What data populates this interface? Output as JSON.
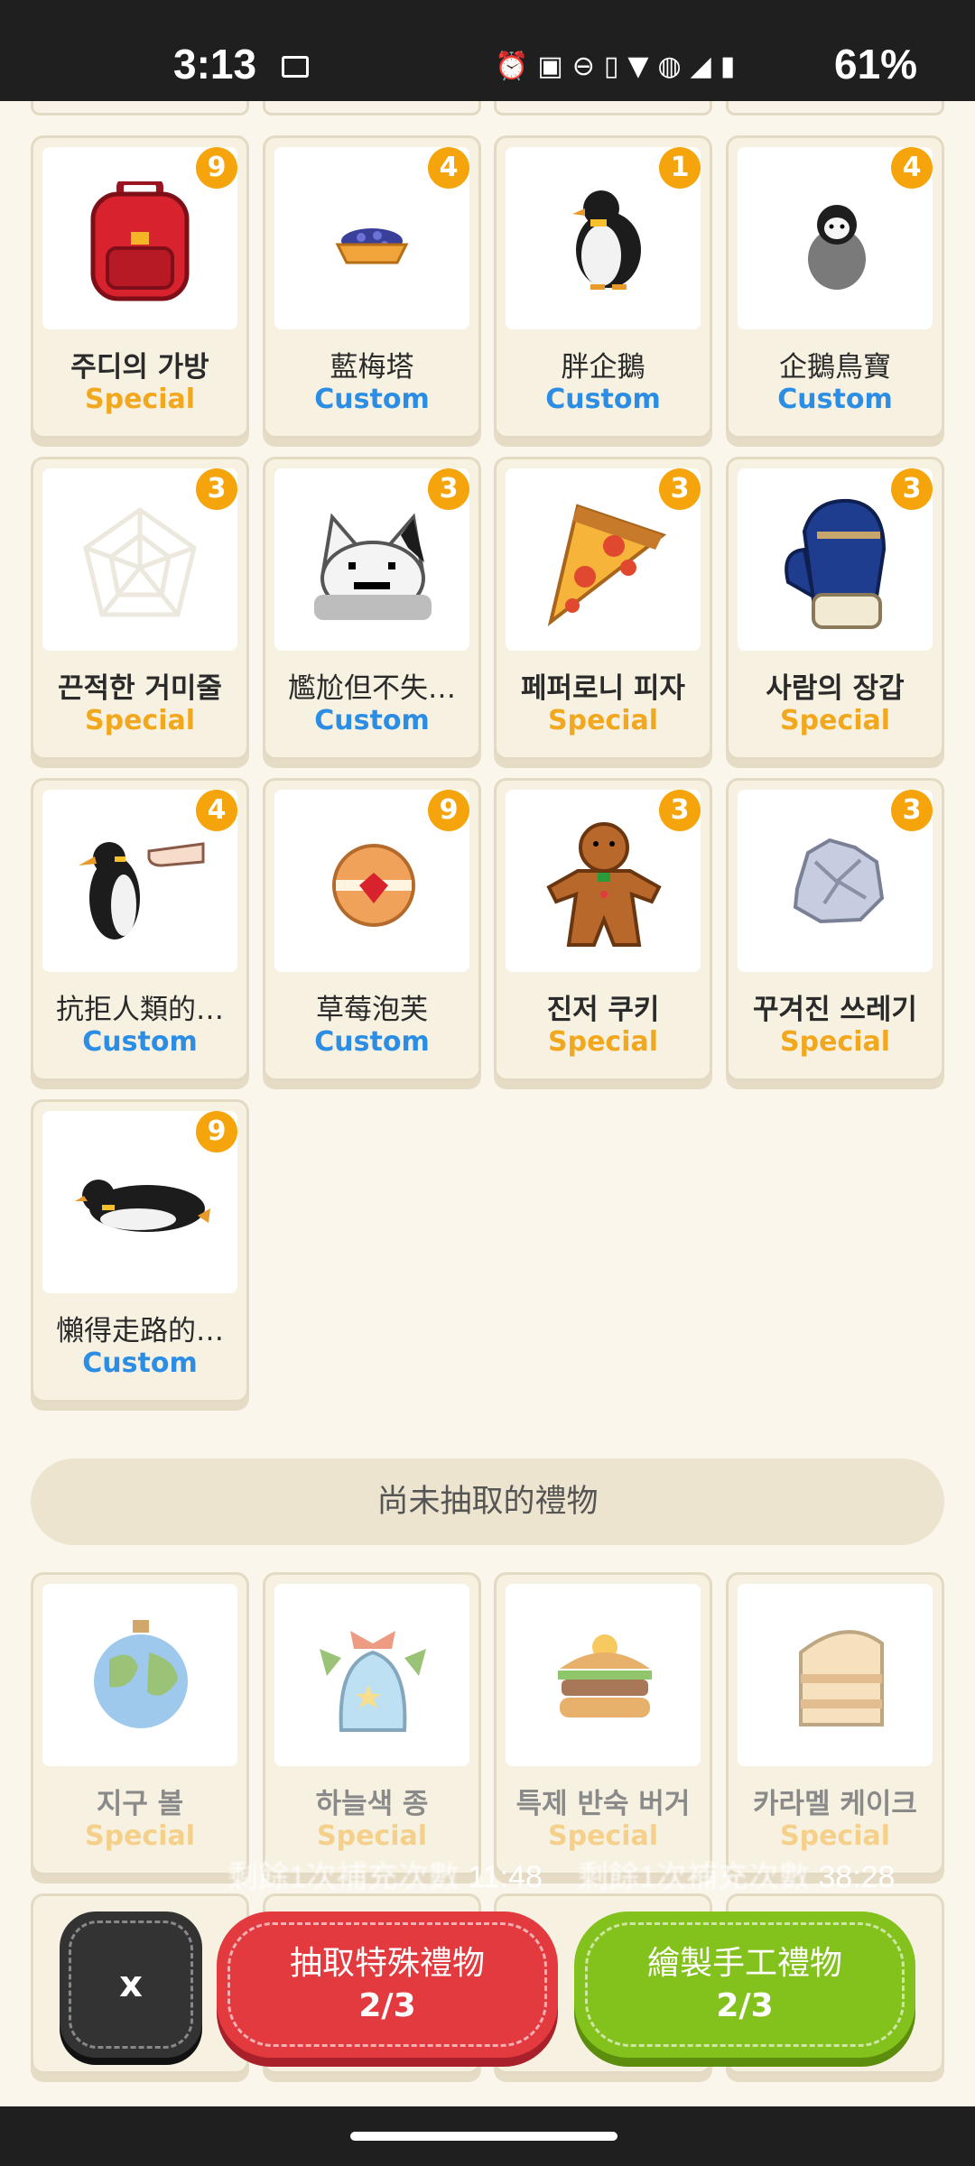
{
  "status_bar": {
    "time": "3:13",
    "battery": "61%",
    "icons": [
      "image-icon",
      "alarm-icon",
      "auto-hz-icon",
      "dnd-icon",
      "vibrate-icon",
      "wifi-icon",
      "volte-icon",
      "signal-icon",
      "battery-icon"
    ]
  },
  "owned_gifts": [
    {
      "name": "주디의 가방",
      "type": "Special",
      "count": "9",
      "icon": "red-backpack"
    },
    {
      "name": "藍梅塔",
      "type": "Custom",
      "count": "4",
      "icon": "blueberry-tart"
    },
    {
      "name": "胖企鵝",
      "type": "Custom",
      "count": "1",
      "icon": "fat-penguin"
    },
    {
      "name": "企鵝鳥寶",
      "type": "Custom",
      "count": "4",
      "icon": "baby-penguin"
    },
    {
      "name": "끈적한 거미줄",
      "type": "Special",
      "count": "3",
      "icon": "spider-web"
    },
    {
      "name": "尷尬但不失…",
      "type": "Custom",
      "count": "3",
      "icon": "awkward-cat"
    },
    {
      "name": "페퍼로니 피자",
      "type": "Special",
      "count": "3",
      "icon": "pizza-slice"
    },
    {
      "name": "사람의 장갑",
      "type": "Special",
      "count": "3",
      "icon": "mitten"
    },
    {
      "name": "抗拒人類的…",
      "type": "Custom",
      "count": "4",
      "icon": "penguin-hand"
    },
    {
      "name": "草莓泡芙",
      "type": "Custom",
      "count": "9",
      "icon": "strawberry-puff"
    },
    {
      "name": "진저 쿠키",
      "type": "Special",
      "count": "3",
      "icon": "gingerbread"
    },
    {
      "name": "꾸겨진 쓰레기",
      "type": "Special",
      "count": "3",
      "icon": "crumpled-trash"
    },
    {
      "name": "懶得走路的…",
      "type": "Custom",
      "count": "9",
      "icon": "lying-penguin"
    }
  ],
  "section_header": "尚未抽取的禮物",
  "undrawn_gifts": [
    {
      "name": "지구 볼",
      "type": "Special",
      "icon": "earth-ornament"
    },
    {
      "name": "하늘색 종",
      "type": "Special",
      "icon": "sky-bell"
    },
    {
      "name": "특제 반숙 버거",
      "type": "Special",
      "icon": "egg-burger"
    },
    {
      "name": "카라멜 케이크",
      "type": "Special",
      "icon": "caramel-cake"
    }
  ],
  "timers": {
    "left_prefix": "剩餘1次補充次數",
    "left_time": "11:48",
    "right_prefix": "剩餘1次補充次數",
    "right_time": "38:28"
  },
  "buttons": {
    "close": "x",
    "draw_special": "抽取特殊禮物",
    "draw_special_count": "2/3",
    "draw_custom": "繪製手工禮物",
    "draw_custom_count": "2/3"
  },
  "colors": {
    "background": "#faf6ec",
    "special": "#f2a81e",
    "custom": "#2b8de3",
    "badge": "#f6a40c",
    "red_button": "#e23a3f",
    "green_button": "#83c11c"
  }
}
